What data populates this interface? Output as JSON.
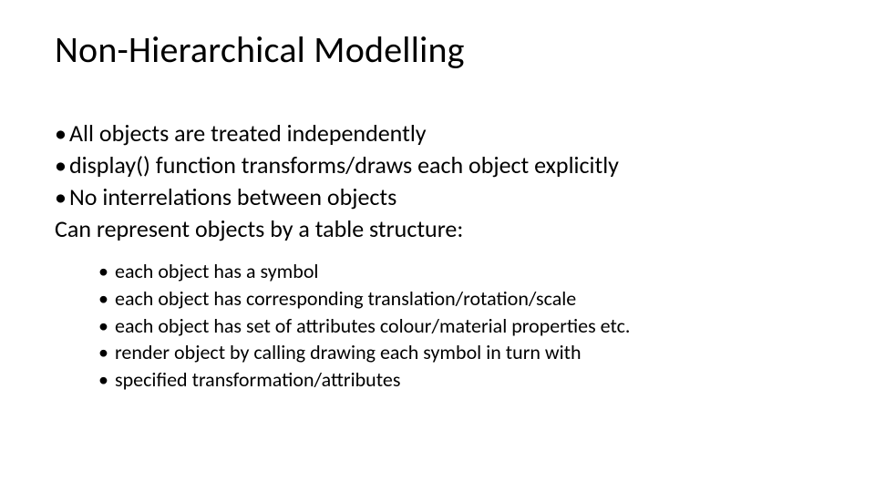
{
  "title": "Non-Hierarchical Modelling",
  "bullets": {
    "b1": "All objects are treated independently",
    "b2": "display() function transforms/draws each object explicitly",
    "b3": "No interrelations between objects",
    "b4": "Can represent objects by a table structure:"
  },
  "sub_bullets": {
    "s1": "each object has a symbol",
    "s2": "each object has corresponding translation/rotation/scale",
    "s3": "each object has set of attributes colour/material properties etc.",
    "s4": "render object by calling drawing each symbol in turn with",
    "s5": "specified transformation/attributes"
  }
}
